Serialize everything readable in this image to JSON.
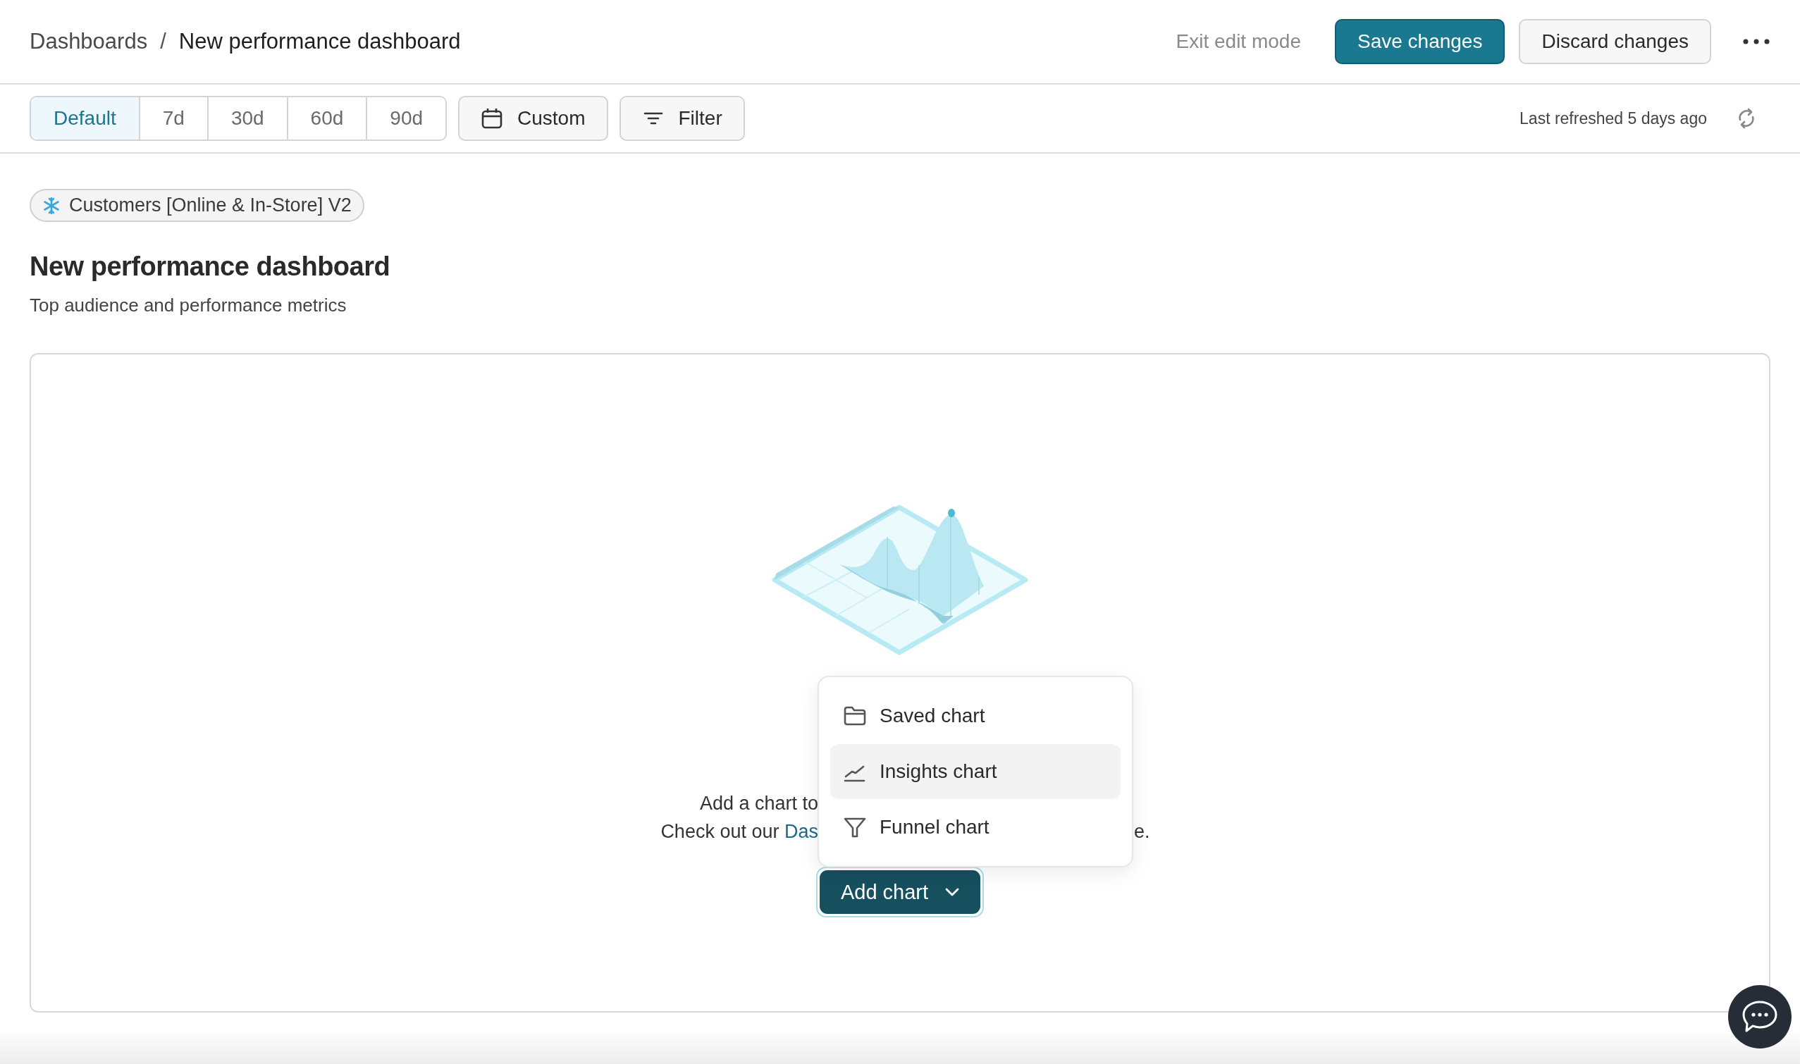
{
  "breadcrumb": [
    {
      "label": "Dashboards",
      "current": false
    },
    {
      "label": "New performance dashboard",
      "current": true
    }
  ],
  "breadcrumb_separator": "/",
  "header_actions": {
    "exit": "Exit edit mode",
    "save": "Save changes",
    "discard": "Discard changes"
  },
  "date_ranges": [
    {
      "label": "Default",
      "selected": true
    },
    {
      "label": "7d",
      "selected": false
    },
    {
      "label": "30d",
      "selected": false
    },
    {
      "label": "60d",
      "selected": false
    },
    {
      "label": "90d",
      "selected": false
    }
  ],
  "custom_button": "Custom",
  "filter_button": "Filter",
  "last_refreshed": "Last refreshed 5 days ago",
  "dataset_chip": "Customers [Online & In-Store] V2",
  "title": "New performance dashboard",
  "subtitle": "Top audience and performance metrics",
  "empty_state": {
    "line_1": "Add a chart to",
    "line_2_start": "Check out our",
    "line_2_link": "Das",
    "line_2_end": "e."
  },
  "add_chart_button": "Add chart",
  "add_chart_menu": [
    {
      "label": "Saved chart",
      "kind": "saved",
      "selected": false
    },
    {
      "label": "Insights chart",
      "kind": "insights",
      "selected": true
    },
    {
      "label": "Funnel chart",
      "kind": "funnel",
      "selected": false
    }
  ]
}
